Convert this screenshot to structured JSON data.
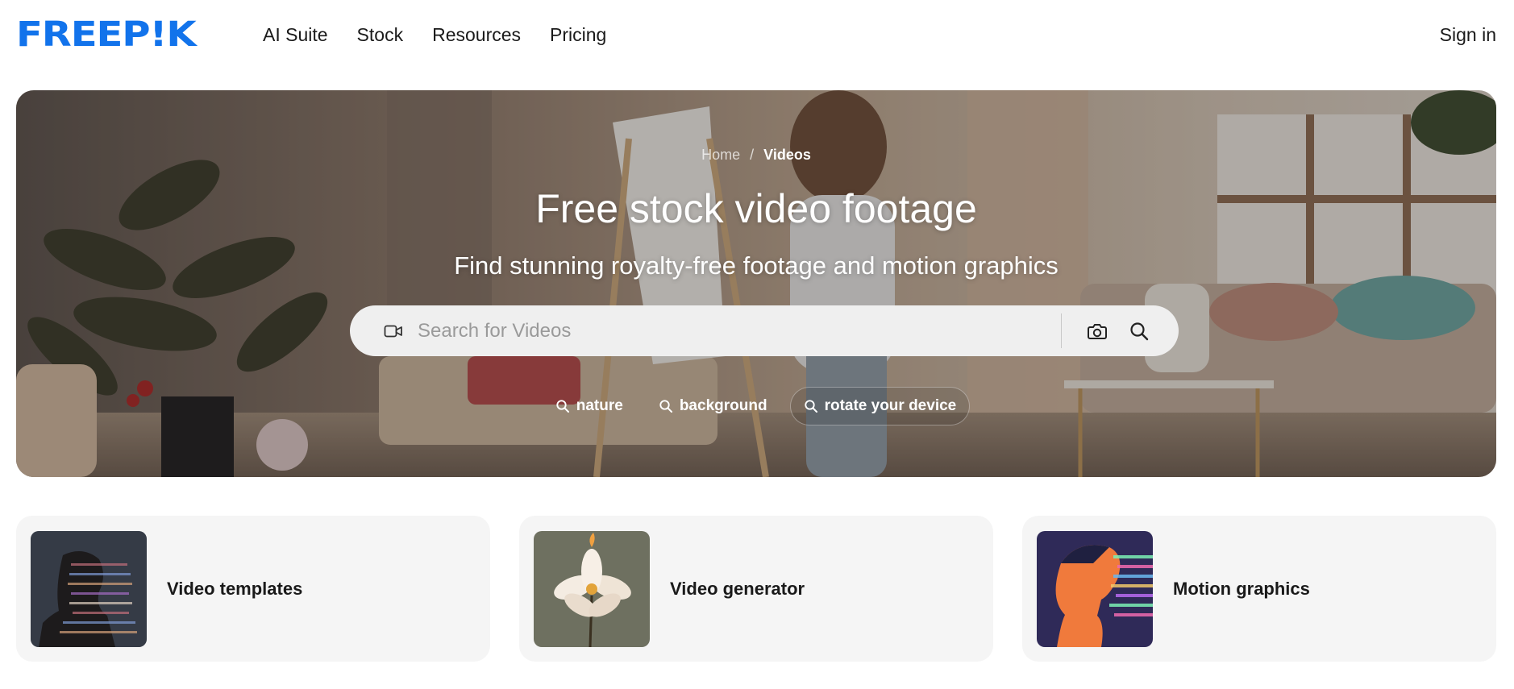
{
  "header": {
    "logo_text": "FREEP!K",
    "nav": [
      {
        "label": "AI Suite"
      },
      {
        "label": "Stock"
      },
      {
        "label": "Resources"
      },
      {
        "label": "Pricing"
      }
    ],
    "signin_label": "Sign in"
  },
  "hero": {
    "breadcrumb": {
      "home": "Home",
      "separator": "/",
      "current": "Videos"
    },
    "title": "Free stock video footage",
    "subtitle": "Find stunning royalty-free footage and motion graphics",
    "search": {
      "placeholder": "Search for Videos",
      "value": "",
      "leading_icon": "video-camera-icon",
      "camera_icon": "camera-icon",
      "search_icon": "search-icon"
    },
    "suggestions": [
      {
        "label": "nature",
        "icon": "search-icon"
      },
      {
        "label": "background",
        "icon": "search-icon"
      },
      {
        "label": "rotate your device",
        "icon": "search-icon"
      }
    ]
  },
  "cards": [
    {
      "label": "Video templates"
    },
    {
      "label": "Video generator"
    },
    {
      "label": "Motion graphics"
    }
  ],
  "colors": {
    "brand": "#1273eb",
    "card_bg": "#f5f5f5",
    "search_bg": "#efefef",
    "text": "#1a1a1a"
  }
}
